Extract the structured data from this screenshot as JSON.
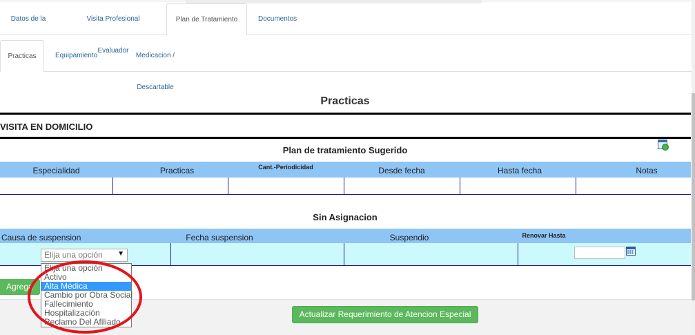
{
  "main_tabs": [
    {
      "label": "Datos de la ID",
      "active": false
    },
    {
      "label": "Visita Profesional Evaluador",
      "active": false
    },
    {
      "label": "Plan de Tratamiento",
      "active": true
    },
    {
      "label": "Documentos",
      "active": false
    }
  ],
  "sub_tabs": [
    {
      "label": "Practicas",
      "active": true
    },
    {
      "label": "Equipamiento",
      "active": false
    },
    {
      "label": "Medicacion / Descartable",
      "active": false
    }
  ],
  "section_title": "Practicas",
  "visita_label": "VISITA EN DOMICILIO",
  "plan": {
    "title": "Plan de tratamiento Sugerido",
    "columns": [
      "Especialidad",
      "Practicas",
      "Cant.-Periodicidad",
      "Desde fecha",
      "Hasta fecha",
      "Notas"
    ]
  },
  "sin_asignacion": {
    "title": "Sin Asignacion",
    "columns": [
      "Causa de suspension",
      "Fecha suspension",
      "Suspendio",
      "Renovar Hasta"
    ],
    "select_value": "Elija una opción",
    "select_arrow": "▼",
    "options": [
      {
        "label": "Elija una opción",
        "selected": false
      },
      {
        "label": "Activo",
        "selected": false
      },
      {
        "label": "Alta Médica",
        "selected": true
      },
      {
        "label": "Cambio por Obra Social",
        "selected": false
      },
      {
        "label": "Fallecimiento",
        "selected": false
      },
      {
        "label": "Hospitalización",
        "selected": false
      },
      {
        "label": "Reclamo Del Afiliado",
        "selected": false
      }
    ]
  },
  "buttons": {
    "agregar": "Agrega",
    "actualizar": "Actualizar Requerimiento de Atencion Especial"
  },
  "colors": {
    "header_row": "#8ec5f5",
    "input_row": "#ccf9fb",
    "button_green": "#5cb85c",
    "highlight_red": "#e3141b"
  }
}
